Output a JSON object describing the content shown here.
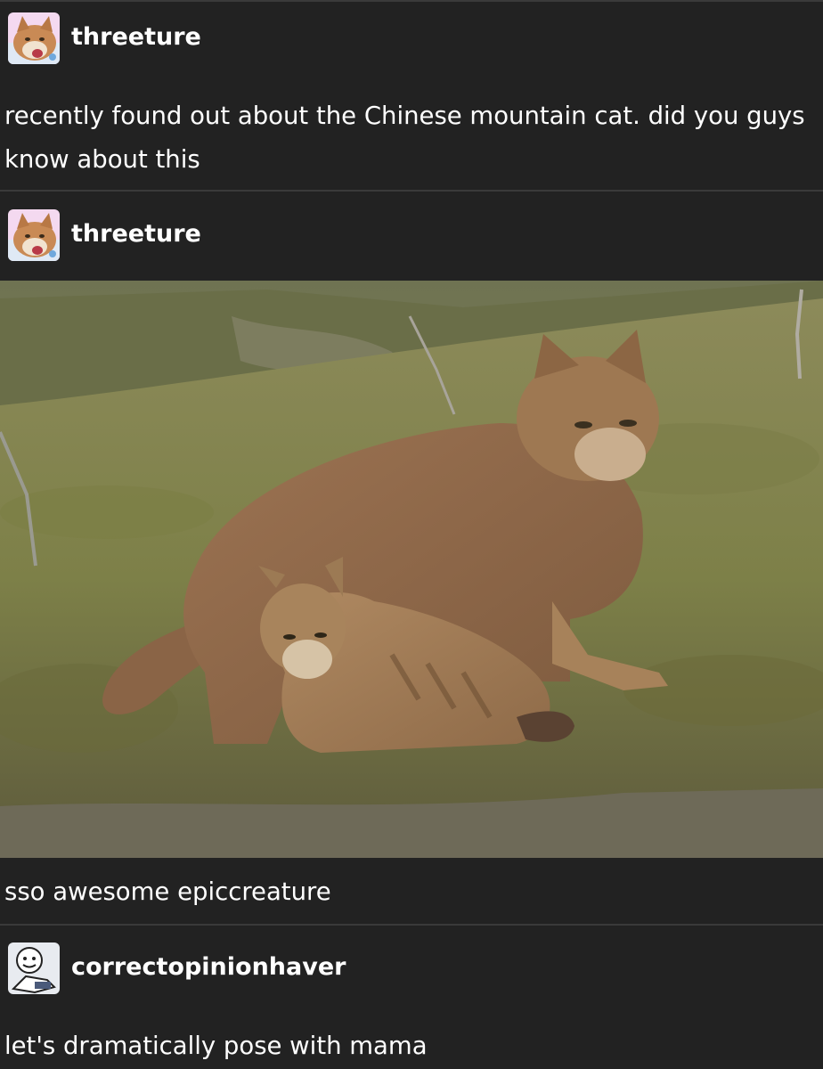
{
  "posts": [
    {
      "username": "threeture",
      "text": "recently found out about the Chinese mountain cat. did you guys know about this"
    },
    {
      "username": "threeture",
      "image_alt": "photo",
      "caption": "sso awesome epiccreature"
    },
    {
      "username": "correctopinionhaver",
      "text": "let's dramatically pose with mama"
    }
  ],
  "colors": {
    "background": "#222222",
    "divider": "#3a3a3a",
    "text": "#ffffff"
  }
}
